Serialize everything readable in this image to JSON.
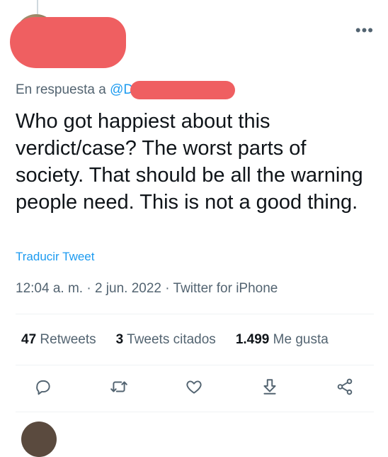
{
  "reply": {
    "prefix": "En respuesta a",
    "handle": "@D"
  },
  "tweet": {
    "text": "Who got happiest about this verdict/case? The worst parts of society. That should be all the warning people need. This is not a good thing.",
    "translate_label": "Traducir Tweet",
    "time": "12:04 a. m.",
    "date": "2 jun. 2022",
    "source": "Twitter for iPhone",
    "separator": "·"
  },
  "stats": {
    "retweets_count": "47",
    "retweets_label": "Retweets",
    "quotes_count": "3",
    "quotes_label": "Tweets citados",
    "likes_count": "1.499",
    "likes_label": "Me gusta"
  },
  "menu": {
    "more_label": "•••"
  },
  "icons": [
    "reply-icon",
    "retweet-icon",
    "like-icon",
    "share-download-icon",
    "share-icon"
  ],
  "colors": {
    "accent": "#1d9bf0",
    "secondary_text": "#536471",
    "redaction": "#ef5f61"
  }
}
